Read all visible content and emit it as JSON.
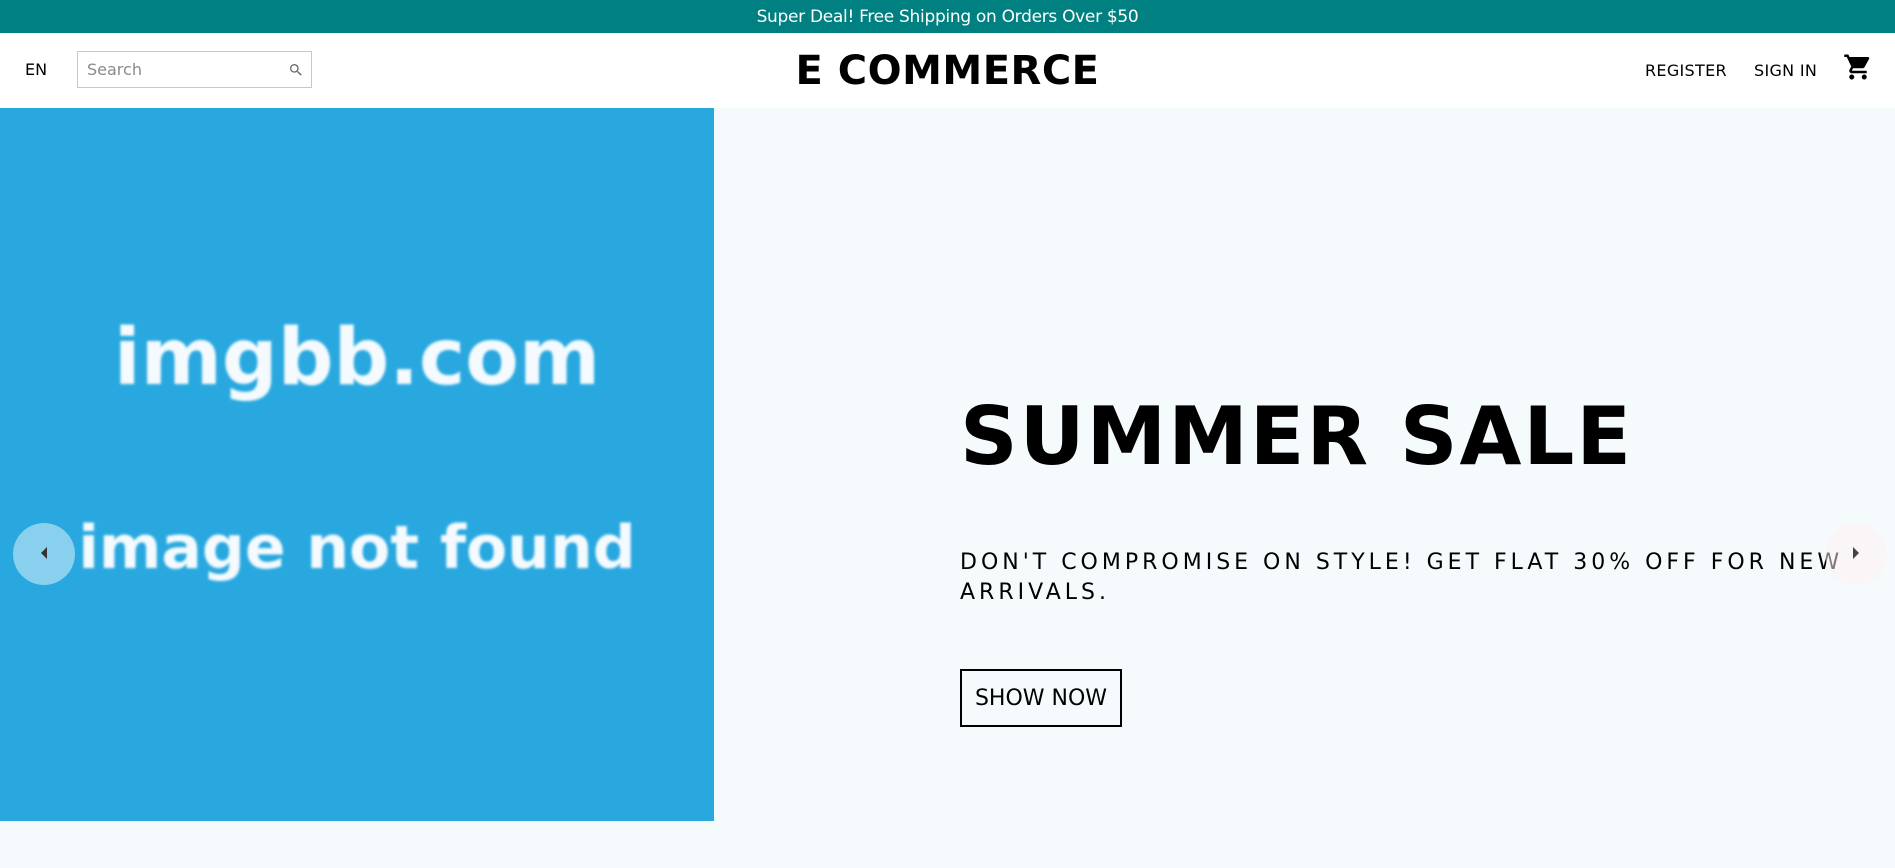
{
  "announcement": {
    "text": "Super Deal! Free Shipping on Orders Over $50"
  },
  "nav": {
    "language": "EN",
    "search_placeholder": "Search",
    "logo": "E COMMERCE",
    "register": "REGISTER",
    "sign_in": "SIGN IN"
  },
  "slide": {
    "image_text_line1": "imgbb.com",
    "image_text_line2": "image not found",
    "title": "SUMMER SALE",
    "description": "DON'T COMPROMISE ON STYLE! GET FLAT 30% OFF FOR NEW ARRIVALS.",
    "button": "SHOW NOW"
  },
  "icons": {
    "search": "search-icon",
    "cart": "shopping-cart-icon",
    "prev": "arrow-left-icon",
    "next": "arrow-right-icon"
  },
  "colors": {
    "announcement_bg": "#008080",
    "image_panel_bg": "#29a8e0",
    "slide_bg": "#f5fafd"
  }
}
